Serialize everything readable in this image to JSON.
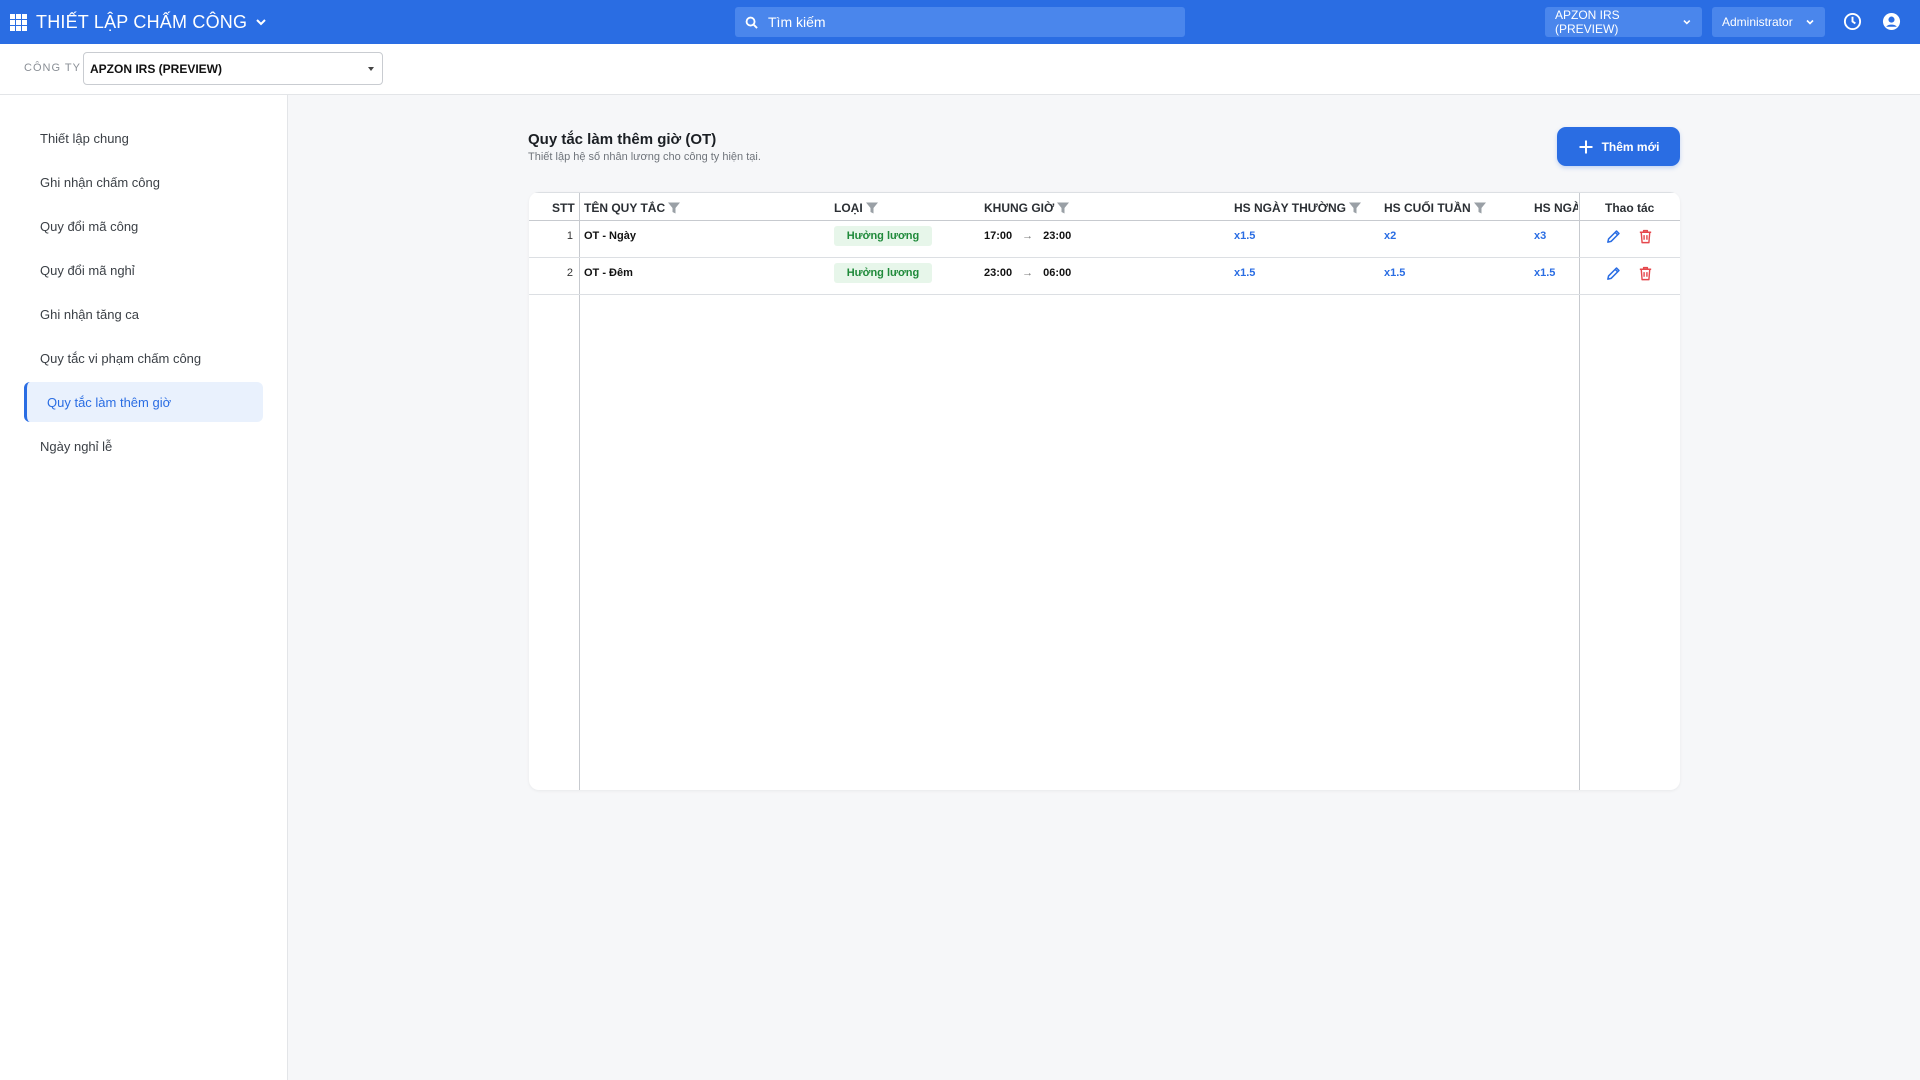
{
  "topbar": {
    "app_title": "THIẾT LẬP CHẤM CÔNG",
    "search_placeholder": "Tìm kiếm",
    "company": "APZON IRS (PREVIEW)",
    "user": "Administrator",
    "colors": {
      "bar": "#2a6de3",
      "control": "#4a86ec"
    }
  },
  "filter": {
    "label": "CÔNG TY",
    "company_value": "APZON IRS (PREVIEW)"
  },
  "sidebar": {
    "items": [
      {
        "label": "Thiết lập chung"
      },
      {
        "label": "Ghi nhận chấm công"
      },
      {
        "label": "Quy đổi mã công"
      },
      {
        "label": "Quy đổi mã nghỉ"
      },
      {
        "label": "Ghi nhận tăng ca"
      },
      {
        "label": "Quy tắc vi phạm chấm công"
      },
      {
        "label": "Quy tắc làm thêm giờ",
        "active": true
      },
      {
        "label": "Ngày nghỉ lễ"
      }
    ]
  },
  "main": {
    "title": "Quy tắc làm thêm giờ (OT)",
    "subtitle": "Thiết lập hệ số nhân lương cho công ty hiện tại.",
    "add_button": "Thêm mới",
    "table": {
      "columns": {
        "stt": "STT",
        "name": "TÊN QUY TẮC",
        "type": "LOẠI",
        "time": "KHUNG GIỜ",
        "weekday": "HS NGÀY THƯỜNG",
        "weekend": "HS CUỐI TUẦN",
        "holiday": "HS NGÀ",
        "actions": "Thao tác"
      },
      "rows": [
        {
          "stt": "1",
          "name": "OT - Ngày",
          "type": "Hưởng lương",
          "start": "17:00",
          "arrow": "→",
          "end": "23:00",
          "weekday": "x1.5",
          "weekend": "x2",
          "holiday": "x3"
        },
        {
          "stt": "2",
          "name": "OT - Đêm",
          "type": "Hưởng lương",
          "start": "23:00",
          "arrow": "→",
          "end": "06:00",
          "weekday": "x1.5",
          "weekend": "x1.5",
          "holiday": "x1.5"
        }
      ]
    }
  },
  "icons": [
    "apps-icon",
    "chevron-down-icon",
    "search-icon",
    "clock-icon",
    "user-circle-icon",
    "plus-icon",
    "filter-icon",
    "edit-pencil-icon",
    "trash-icon"
  ]
}
